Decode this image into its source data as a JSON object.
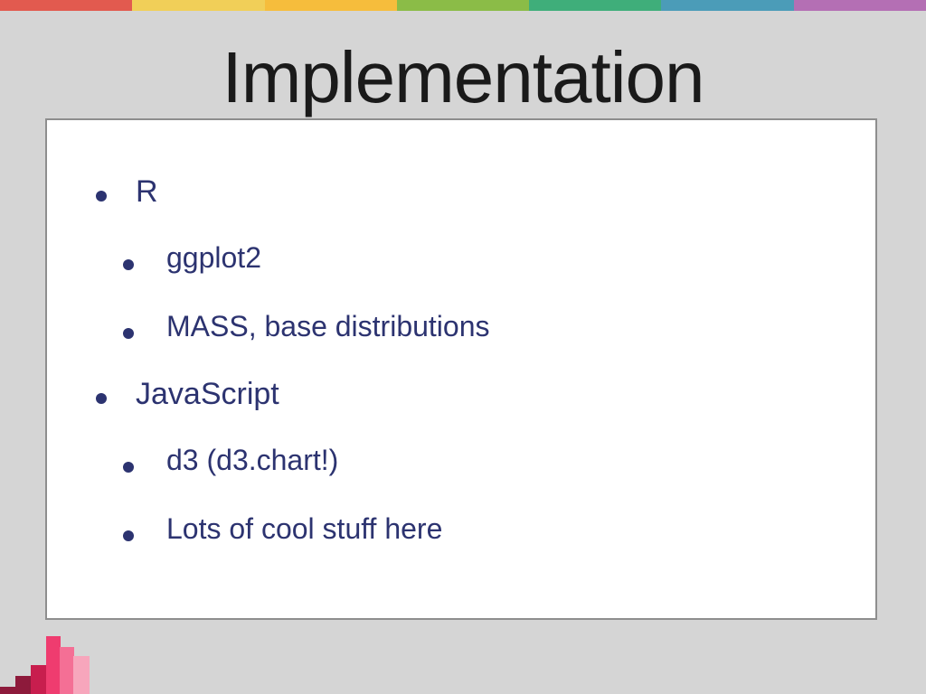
{
  "slide": {
    "title": "Implementation",
    "bullets": [
      {
        "level": 1,
        "text": "R"
      },
      {
        "level": 2,
        "text": "ggplot2"
      },
      {
        "level": 2,
        "text": "MASS, base distributions"
      },
      {
        "level": 1,
        "text": "JavaScript"
      },
      {
        "level": 2,
        "text": "d3 (d3.chart!)"
      },
      {
        "level": 2,
        "text": "Lots of cool stuff here"
      }
    ]
  },
  "colors": {
    "background": "#d5d5d5",
    "bullet_text": "#2c3370",
    "top_bar": [
      "#e25a4f",
      "#f1cf58",
      "#f6bd3c",
      "#8bbc47",
      "#3fae7a",
      "#4b9cb8",
      "#b46fb4"
    ],
    "corner_bars": [
      "#8d1a3b",
      "#c81e4e",
      "#ef3c6f",
      "#f46f95",
      "#f7a6bc"
    ]
  }
}
